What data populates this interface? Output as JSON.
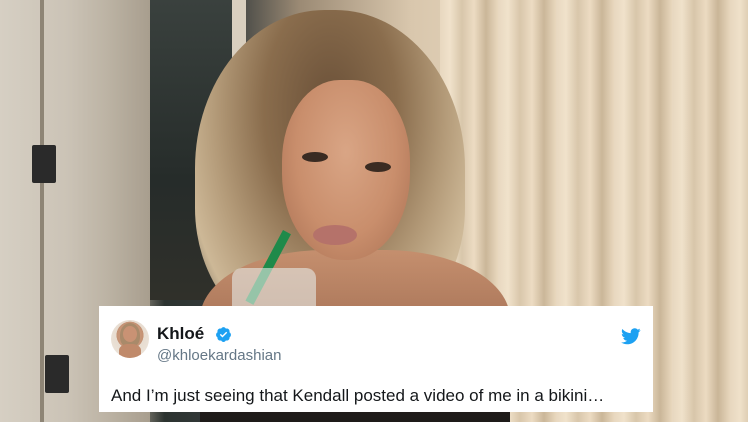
{
  "tweet": {
    "display_name": "Khloé",
    "handle": "@khloekardashian",
    "text": "And I’m just seeing that Kendall posted a video of me in a bikini…",
    "verified": true,
    "icons": {
      "verified": "verified-badge-icon",
      "platform": "twitter-bird-icon",
      "avatar": "profile-avatar"
    },
    "colors": {
      "verified_blue": "#1da1f2",
      "twitter_blue": "#1da1f2",
      "name_text": "#14171a",
      "handle_text": "#657786",
      "card_bg": "#ffffff"
    }
  }
}
